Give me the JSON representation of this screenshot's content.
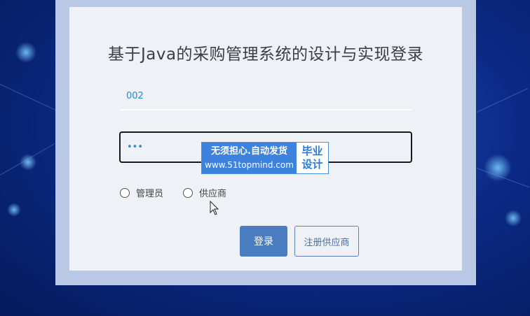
{
  "page": {
    "title": "基于Java的采购管理系统的设计与实现登录"
  },
  "form": {
    "username_value": "002",
    "password_value": "•••",
    "roles": [
      {
        "label": "管理员",
        "selected": false
      },
      {
        "label": "供应商",
        "selected": false
      }
    ],
    "login_label": "登录",
    "register_label": "注册供应商"
  },
  "watermark": {
    "line1": "无须担心.自动发货",
    "line2": "www.51topmind.com",
    "badge_top": "毕业",
    "badge_bottom": "设计"
  },
  "colors": {
    "background": "#0b2a86",
    "frame": "#b9c8e4",
    "card": "#eef1f6",
    "primary_button": "#4a7cc1",
    "input_text": "#2a8ac9"
  }
}
